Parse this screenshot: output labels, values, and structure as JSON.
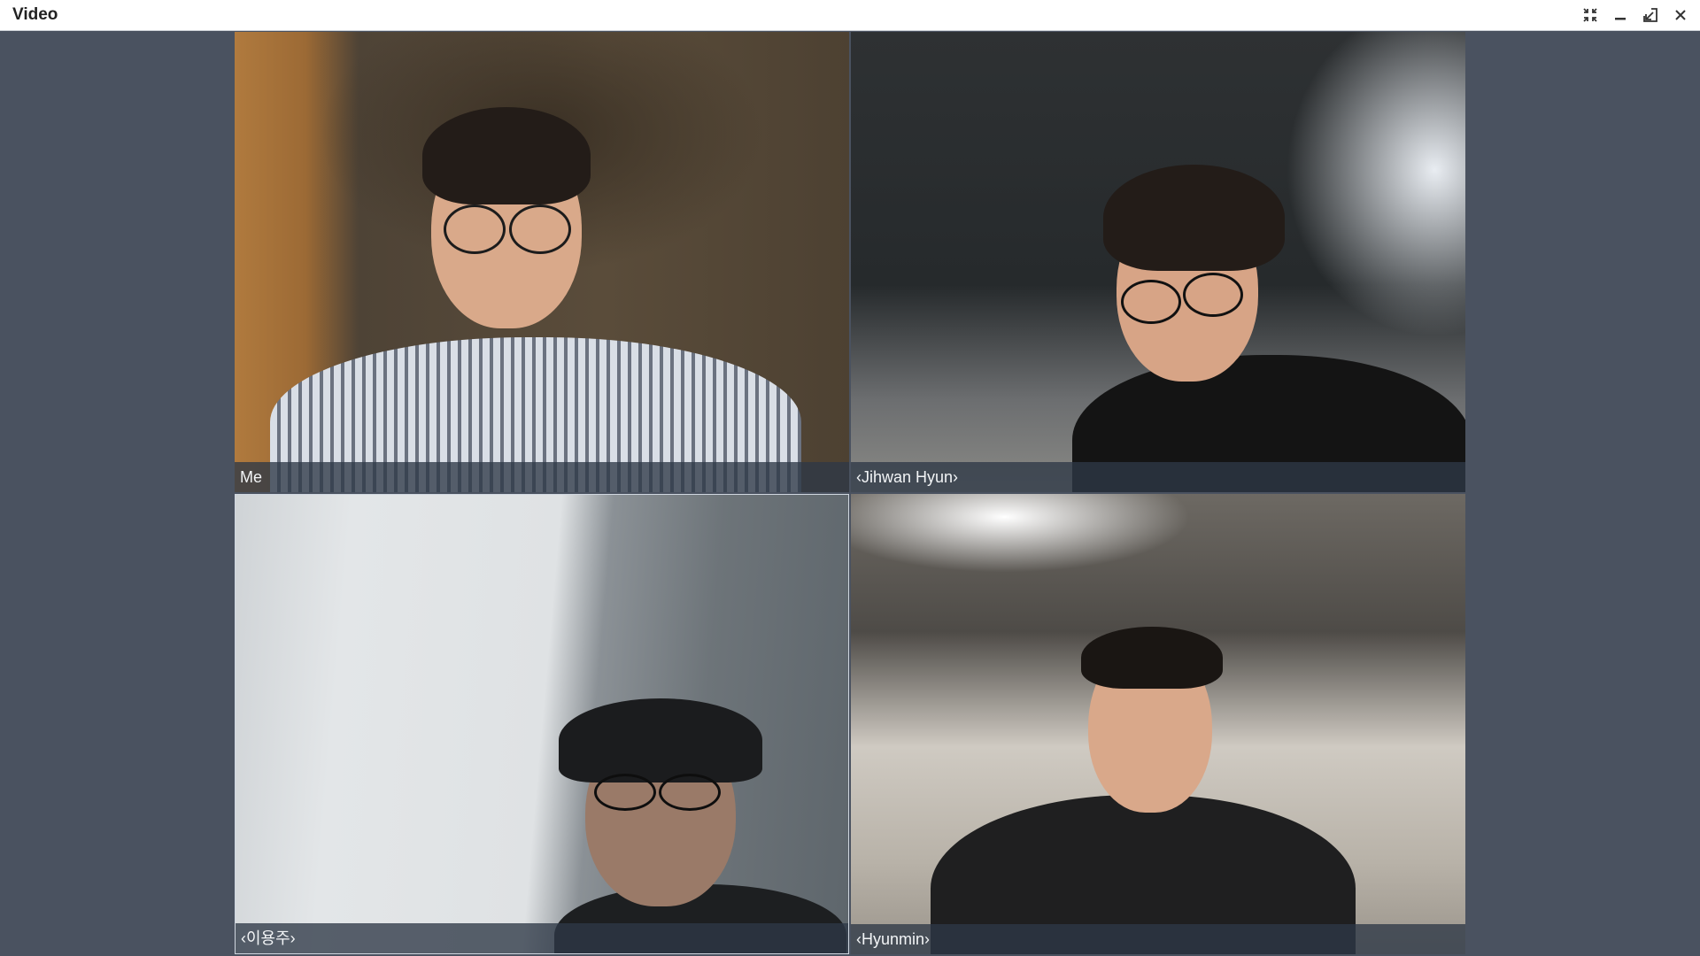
{
  "window": {
    "title": "Video"
  },
  "controls": {
    "icons": [
      "exit-fullscreen-icon",
      "minimize-icon",
      "popout-icon",
      "close-icon"
    ]
  },
  "participants": [
    {
      "label": "Me"
    },
    {
      "label": "‹Jihwan Hyun›"
    },
    {
      "label": "‹이용주›"
    },
    {
      "label": "‹Hyunmin›"
    }
  ],
  "colors": {
    "background": "#4a5260",
    "titlebar": "#ffffff",
    "label_bar": "#2e3846"
  }
}
